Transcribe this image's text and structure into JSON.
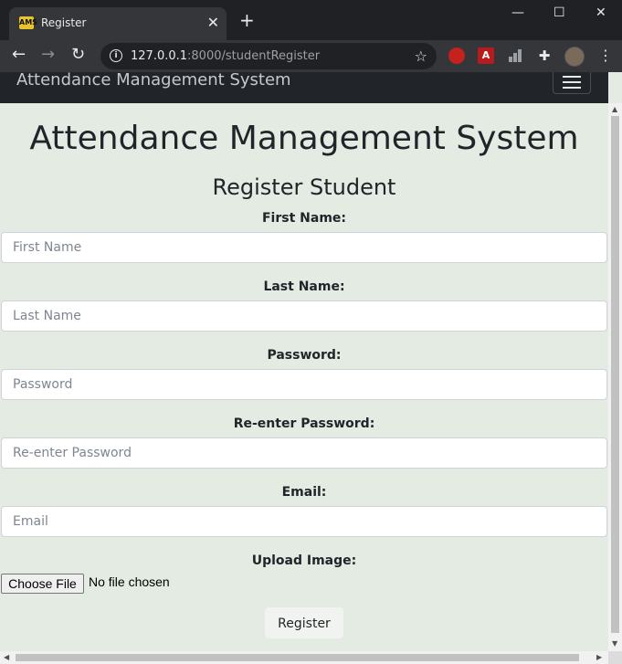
{
  "browser": {
    "tab_title": "Register",
    "favicon_text": "AMS",
    "url_host": "127.0.0.1",
    "url_path": ":8000/studentRegister"
  },
  "navbar": {
    "brand": "Attendance Management System"
  },
  "page": {
    "title": "Attendance Management System",
    "subtitle": "Register Student"
  },
  "form": {
    "first_name": {
      "label": "First Name:",
      "placeholder": "First Name"
    },
    "last_name": {
      "label": "Last Name:",
      "placeholder": "Last Name"
    },
    "password": {
      "label": "Password:",
      "placeholder": "Password"
    },
    "reenter_password": {
      "label": "Re-enter Password:",
      "placeholder": "Re-enter Password"
    },
    "email": {
      "label": "Email:",
      "placeholder": "Email"
    },
    "image": {
      "label": "Upload Image:",
      "button": "Choose File",
      "status": "No file chosen"
    },
    "submit": "Register"
  }
}
